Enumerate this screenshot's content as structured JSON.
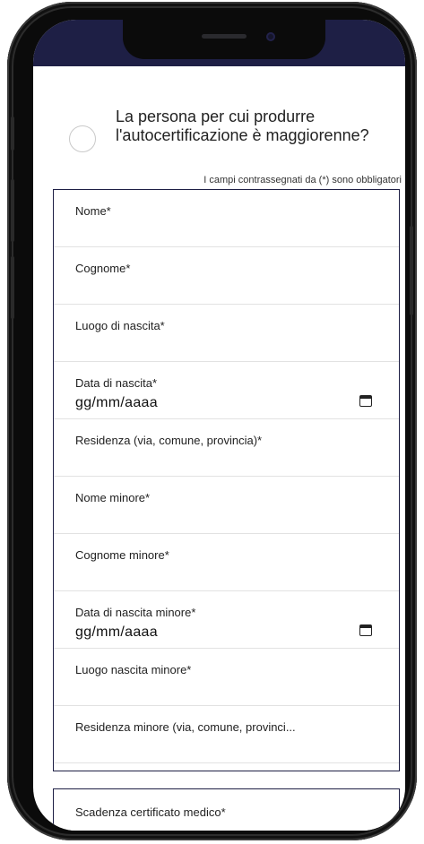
{
  "question": {
    "text_line1": "La persona per cui produrre",
    "text_line2": "l'autocertificazione è maggiorenne?"
  },
  "required_note": "I campi contrassegnati da (*) sono obbligatori",
  "fields": [
    {
      "label": "Nome*"
    },
    {
      "label": "Cognome*"
    },
    {
      "label": "Luogo di nascita*"
    },
    {
      "label": "Data di nascita*",
      "value": "gg/mm/aaaa"
    },
    {
      "label": "Residenza (via, comune, provincia)*"
    },
    {
      "label": "Nome minore*"
    },
    {
      "label": "Cognome minore*"
    },
    {
      "label": "Data di nascita minore*",
      "value": "gg/mm/aaaa"
    },
    {
      "label": "Luogo nascita minore*"
    },
    {
      "label": "Residenza minore (via, comune, provinci..."
    }
  ],
  "second_box": {
    "label": "Scadenza certificato medico*"
  },
  "colors": {
    "header": "#1e1f45",
    "border": "#1e1f45"
  }
}
